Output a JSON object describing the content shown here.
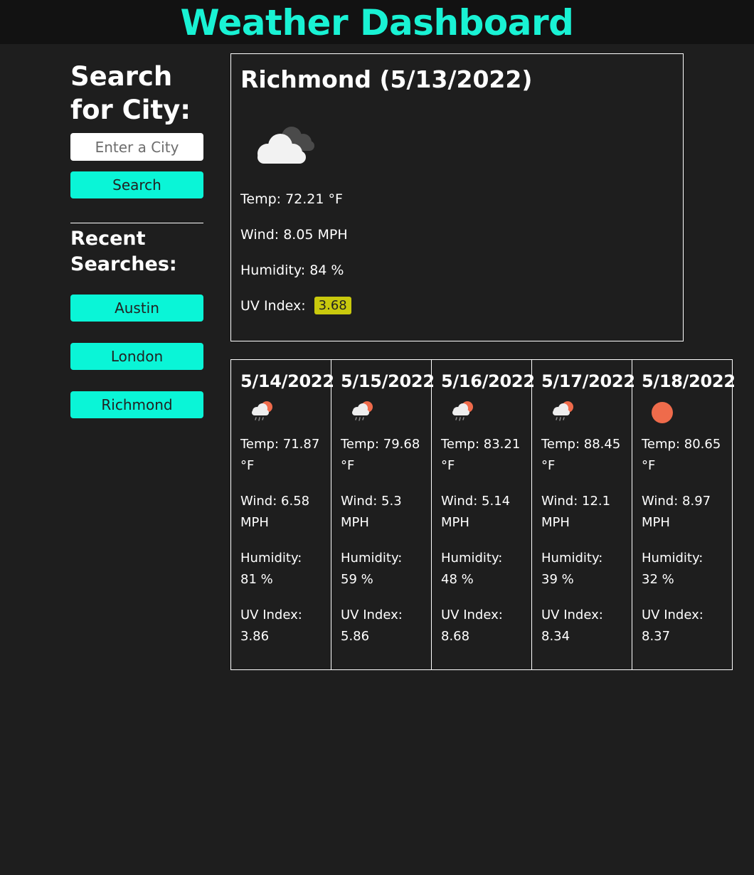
{
  "header": {
    "title": "Weather Dashboard"
  },
  "sidebar": {
    "search_heading": "Search for City:",
    "input": {
      "placeholder": "Enter a City",
      "value": ""
    },
    "search_button": "Search",
    "recent_heading": "Recent Searches:",
    "recent": [
      "Austin",
      "London",
      "Richmond"
    ]
  },
  "current": {
    "title": "Richmond (5/13/2022)",
    "icon": "cloud-icon",
    "temp": "Temp: 72.21 °F",
    "wind": "Wind: 8.05 MPH",
    "humidity": "Humidity: 84 %",
    "uv_label": "UV Index:",
    "uv_value": "3.68",
    "uv_color": "#c9c90d"
  },
  "forecast": [
    {
      "date": "5/14/2022",
      "icon": "rain-sun-icon",
      "temp": "Temp: 71.87 °F",
      "wind": "Wind: 6.58 MPH",
      "humidity": "Humidity: 81 %",
      "uv": "UV Index: 3.86"
    },
    {
      "date": "5/15/2022",
      "icon": "rain-sun-icon",
      "temp": "Temp: 79.68 °F",
      "wind": "Wind: 5.3 MPH",
      "humidity": "Humidity: 59 %",
      "uv": "UV Index: 5.86"
    },
    {
      "date": "5/16/2022",
      "icon": "rain-sun-icon",
      "temp": "Temp: 83.21 °F",
      "wind": "Wind: 5.14 MPH",
      "humidity": "Humidity: 48 %",
      "uv": "UV Index: 8.68"
    },
    {
      "date": "5/17/2022",
      "icon": "rain-sun-icon",
      "temp": "Temp: 88.45 °F",
      "wind": "Wind: 12.1 MPH",
      "humidity": "Humidity: 39 %",
      "uv": "UV Index: 8.34"
    },
    {
      "date": "5/18/2022",
      "icon": "sun-icon",
      "temp": "Temp: 80.65 °F",
      "wind": "Wind: 8.97 MPH",
      "humidity": "Humidity: 32 %",
      "uv": "UV Index: 8.37"
    }
  ],
  "colors": {
    "accent": "#0af5d7",
    "title": "#19f2d4",
    "background": "#1e1e1e",
    "header": "#121212",
    "sun": "#ef6b4b"
  }
}
